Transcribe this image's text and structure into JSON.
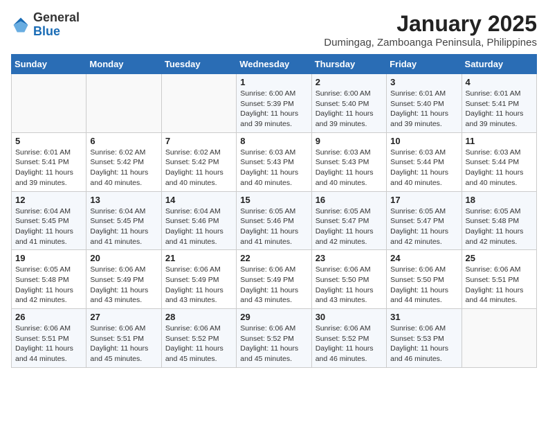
{
  "header": {
    "logo": {
      "general": "General",
      "blue": "Blue"
    },
    "title": "January 2025",
    "subtitle": "Dumingag, Zamboanga Peninsula, Philippines"
  },
  "weekdays": [
    "Sunday",
    "Monday",
    "Tuesday",
    "Wednesday",
    "Thursday",
    "Friday",
    "Saturday"
  ],
  "weeks": [
    [
      {
        "day": "",
        "sunrise": "",
        "sunset": "",
        "daylight": ""
      },
      {
        "day": "",
        "sunrise": "",
        "sunset": "",
        "daylight": ""
      },
      {
        "day": "",
        "sunrise": "",
        "sunset": "",
        "daylight": ""
      },
      {
        "day": "1",
        "sunrise": "Sunrise: 6:00 AM",
        "sunset": "Sunset: 5:39 PM",
        "daylight": "Daylight: 11 hours and 39 minutes."
      },
      {
        "day": "2",
        "sunrise": "Sunrise: 6:00 AM",
        "sunset": "Sunset: 5:40 PM",
        "daylight": "Daylight: 11 hours and 39 minutes."
      },
      {
        "day": "3",
        "sunrise": "Sunrise: 6:01 AM",
        "sunset": "Sunset: 5:40 PM",
        "daylight": "Daylight: 11 hours and 39 minutes."
      },
      {
        "day": "4",
        "sunrise": "Sunrise: 6:01 AM",
        "sunset": "Sunset: 5:41 PM",
        "daylight": "Daylight: 11 hours and 39 minutes."
      }
    ],
    [
      {
        "day": "5",
        "sunrise": "Sunrise: 6:01 AM",
        "sunset": "Sunset: 5:41 PM",
        "daylight": "Daylight: 11 hours and 39 minutes."
      },
      {
        "day": "6",
        "sunrise": "Sunrise: 6:02 AM",
        "sunset": "Sunset: 5:42 PM",
        "daylight": "Daylight: 11 hours and 40 minutes."
      },
      {
        "day": "7",
        "sunrise": "Sunrise: 6:02 AM",
        "sunset": "Sunset: 5:42 PM",
        "daylight": "Daylight: 11 hours and 40 minutes."
      },
      {
        "day": "8",
        "sunrise": "Sunrise: 6:03 AM",
        "sunset": "Sunset: 5:43 PM",
        "daylight": "Daylight: 11 hours and 40 minutes."
      },
      {
        "day": "9",
        "sunrise": "Sunrise: 6:03 AM",
        "sunset": "Sunset: 5:43 PM",
        "daylight": "Daylight: 11 hours and 40 minutes."
      },
      {
        "day": "10",
        "sunrise": "Sunrise: 6:03 AM",
        "sunset": "Sunset: 5:44 PM",
        "daylight": "Daylight: 11 hours and 40 minutes."
      },
      {
        "day": "11",
        "sunrise": "Sunrise: 6:03 AM",
        "sunset": "Sunset: 5:44 PM",
        "daylight": "Daylight: 11 hours and 40 minutes."
      }
    ],
    [
      {
        "day": "12",
        "sunrise": "Sunrise: 6:04 AM",
        "sunset": "Sunset: 5:45 PM",
        "daylight": "Daylight: 11 hours and 41 minutes."
      },
      {
        "day": "13",
        "sunrise": "Sunrise: 6:04 AM",
        "sunset": "Sunset: 5:45 PM",
        "daylight": "Daylight: 11 hours and 41 minutes."
      },
      {
        "day": "14",
        "sunrise": "Sunrise: 6:04 AM",
        "sunset": "Sunset: 5:46 PM",
        "daylight": "Daylight: 11 hours and 41 minutes."
      },
      {
        "day": "15",
        "sunrise": "Sunrise: 6:05 AM",
        "sunset": "Sunset: 5:46 PM",
        "daylight": "Daylight: 11 hours and 41 minutes."
      },
      {
        "day": "16",
        "sunrise": "Sunrise: 6:05 AM",
        "sunset": "Sunset: 5:47 PM",
        "daylight": "Daylight: 11 hours and 42 minutes."
      },
      {
        "day": "17",
        "sunrise": "Sunrise: 6:05 AM",
        "sunset": "Sunset: 5:47 PM",
        "daylight": "Daylight: 11 hours and 42 minutes."
      },
      {
        "day": "18",
        "sunrise": "Sunrise: 6:05 AM",
        "sunset": "Sunset: 5:48 PM",
        "daylight": "Daylight: 11 hours and 42 minutes."
      }
    ],
    [
      {
        "day": "19",
        "sunrise": "Sunrise: 6:05 AM",
        "sunset": "Sunset: 5:48 PM",
        "daylight": "Daylight: 11 hours and 42 minutes."
      },
      {
        "day": "20",
        "sunrise": "Sunrise: 6:06 AM",
        "sunset": "Sunset: 5:49 PM",
        "daylight": "Daylight: 11 hours and 43 minutes."
      },
      {
        "day": "21",
        "sunrise": "Sunrise: 6:06 AM",
        "sunset": "Sunset: 5:49 PM",
        "daylight": "Daylight: 11 hours and 43 minutes."
      },
      {
        "day": "22",
        "sunrise": "Sunrise: 6:06 AM",
        "sunset": "Sunset: 5:49 PM",
        "daylight": "Daylight: 11 hours and 43 minutes."
      },
      {
        "day": "23",
        "sunrise": "Sunrise: 6:06 AM",
        "sunset": "Sunset: 5:50 PM",
        "daylight": "Daylight: 11 hours and 43 minutes."
      },
      {
        "day": "24",
        "sunrise": "Sunrise: 6:06 AM",
        "sunset": "Sunset: 5:50 PM",
        "daylight": "Daylight: 11 hours and 44 minutes."
      },
      {
        "day": "25",
        "sunrise": "Sunrise: 6:06 AM",
        "sunset": "Sunset: 5:51 PM",
        "daylight": "Daylight: 11 hours and 44 minutes."
      }
    ],
    [
      {
        "day": "26",
        "sunrise": "Sunrise: 6:06 AM",
        "sunset": "Sunset: 5:51 PM",
        "daylight": "Daylight: 11 hours and 44 minutes."
      },
      {
        "day": "27",
        "sunrise": "Sunrise: 6:06 AM",
        "sunset": "Sunset: 5:51 PM",
        "daylight": "Daylight: 11 hours and 45 minutes."
      },
      {
        "day": "28",
        "sunrise": "Sunrise: 6:06 AM",
        "sunset": "Sunset: 5:52 PM",
        "daylight": "Daylight: 11 hours and 45 minutes."
      },
      {
        "day": "29",
        "sunrise": "Sunrise: 6:06 AM",
        "sunset": "Sunset: 5:52 PM",
        "daylight": "Daylight: 11 hours and 45 minutes."
      },
      {
        "day": "30",
        "sunrise": "Sunrise: 6:06 AM",
        "sunset": "Sunset: 5:52 PM",
        "daylight": "Daylight: 11 hours and 46 minutes."
      },
      {
        "day": "31",
        "sunrise": "Sunrise: 6:06 AM",
        "sunset": "Sunset: 5:53 PM",
        "daylight": "Daylight: 11 hours and 46 minutes."
      },
      {
        "day": "",
        "sunrise": "",
        "sunset": "",
        "daylight": ""
      }
    ]
  ]
}
